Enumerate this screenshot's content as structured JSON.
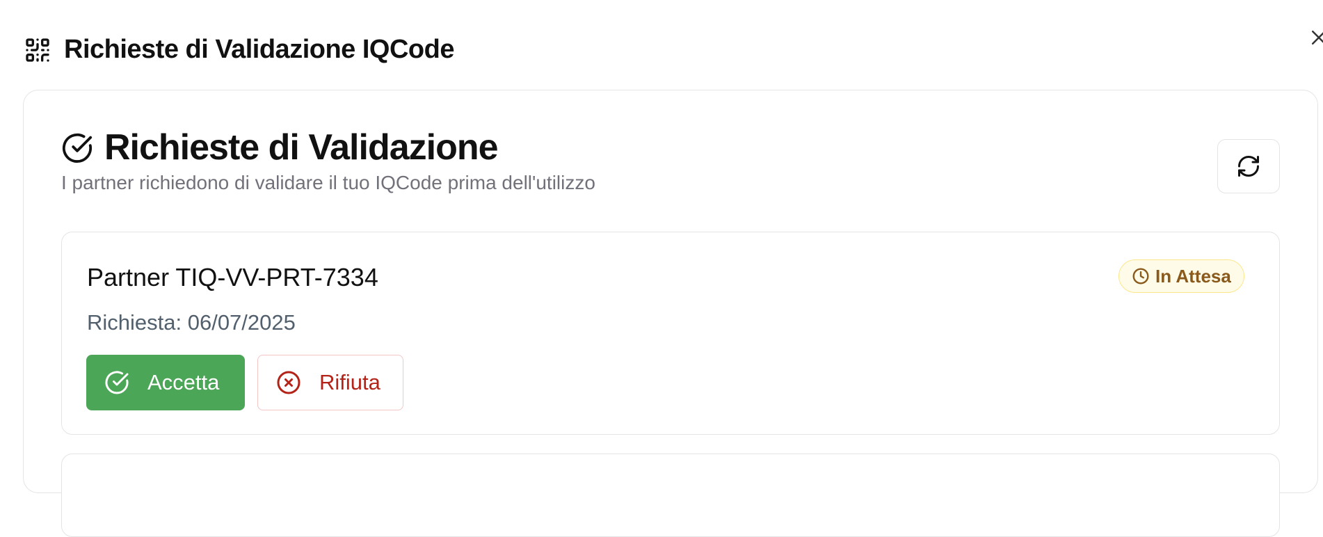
{
  "dialog": {
    "title": "Richieste di Validazione IQCode",
    "icon": "qr-code-icon",
    "close_icon": "close-icon"
  },
  "card": {
    "title": "Richieste di Validazione",
    "title_icon": "check-circle-icon",
    "subtitle": "I partner richiedono di validare il tuo IQCode prima dell'utilizzo",
    "refresh_icon": "refresh-icon"
  },
  "requests": [
    {
      "partner": "Partner TIQ-VV-PRT-7334",
      "status": "In Attesa",
      "status_icon": "clock-icon",
      "date": "Richiesta: 06/07/2025",
      "accept_label": "Accetta",
      "reject_label": "Rifiuta"
    }
  ],
  "colors": {
    "accept": "#4ca658",
    "reject": "#b42318",
    "pending_text": "#8a5a1c",
    "pending_bg": "#fefce8"
  }
}
